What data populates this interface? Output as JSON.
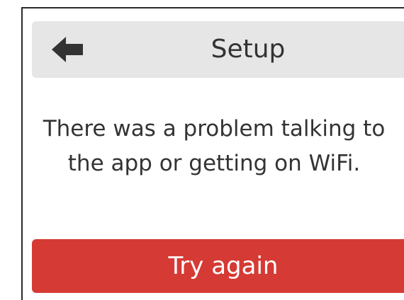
{
  "header": {
    "title": "Setup",
    "back_icon": "arrow-left-icon"
  },
  "message": {
    "line1": "There was a problem talking to",
    "line2": "the app or getting on WiFi."
  },
  "actions": {
    "retry_label": "Try again"
  },
  "colors": {
    "header_bg": "#e6e6e6",
    "primary": "#d63a34",
    "text": "#333333"
  }
}
